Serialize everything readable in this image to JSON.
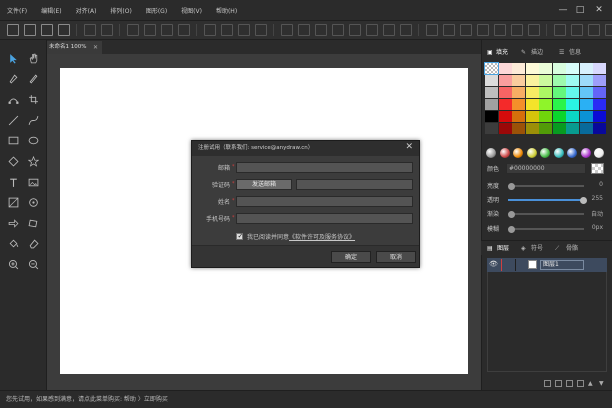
{
  "menu": [
    "文件(F)",
    "编辑(E)",
    "对齐(A)",
    "排列(O)",
    "图形(G)",
    "视图(V)",
    "帮助(H)"
  ],
  "window_controls": {
    "minimize": "—",
    "maximize": "□",
    "close": "✕"
  },
  "document_tab": {
    "label": "未命名1 100%",
    "close": "✕"
  },
  "right_tabs": [
    "填充",
    "描边",
    "信息"
  ],
  "properties": {
    "color_label": "颜色",
    "color_value": "#00000000",
    "brightness_label": "亮度",
    "brightness_value": "0",
    "opacity_label": "透明",
    "opacity_value": "255",
    "blur_label": "渐染",
    "blur_value": "自动",
    "blur2_label": "模糊",
    "blur2_value": "0px"
  },
  "layers_tabs": [
    "图层",
    "符号",
    "骨骼"
  ],
  "layer": {
    "name": "图层1"
  },
  "status_text": "您先试用，如果感到满意，请点此菜单购买: 帮助 〉立即购买",
  "dialog": {
    "title": "注册试用（联系我们: service@anydraw.cn）",
    "close": "✕",
    "fields": {
      "email_label": "邮箱",
      "code_label": "验证码",
      "send_button": "发送邮箱",
      "name_label": "姓名",
      "phone_label": "手机号码",
      "required_mark": "*"
    },
    "agree_prefix": "我已阅读并同意",
    "agree_link": "《软件许可及服务协议》",
    "ok": "确定",
    "cancel": "取消"
  },
  "colors": {
    "panel_bg": "#2b2b2b",
    "workspace": "#3c3c3c",
    "accent": "#4a90d9",
    "required": "#d04040"
  }
}
